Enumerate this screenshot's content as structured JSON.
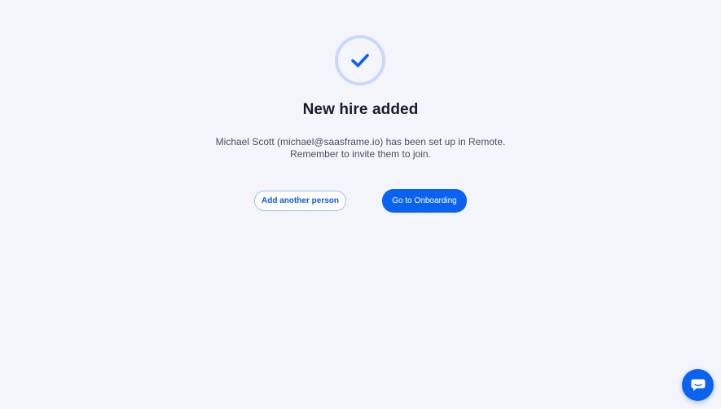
{
  "success": {
    "icon": "checkmark-icon",
    "title": "New hire added",
    "message_line1": "Michael Scott (michael@saasframe.io) has been set up in Remote.",
    "message_line2": "Remember to invite them to join."
  },
  "actions": {
    "secondary_label": "Add another person",
    "primary_label": "Go to Onboarding"
  },
  "chat": {
    "icon": "chat-bubble-icon"
  },
  "colors": {
    "background": "#F4F4FB",
    "accent": "#0A63F0",
    "ring": "#C9D8F7",
    "title_text": "#1B1B29",
    "body_text": "#4A4E62"
  }
}
